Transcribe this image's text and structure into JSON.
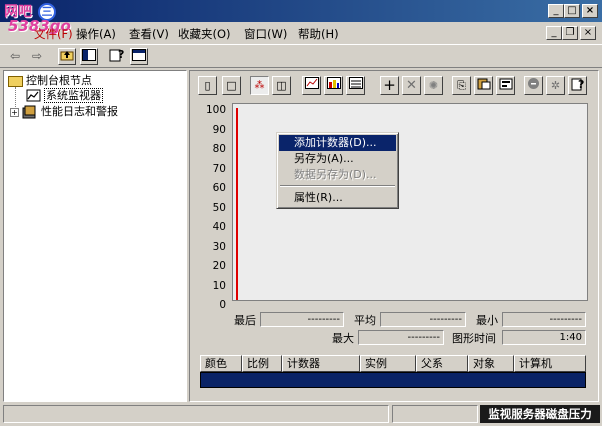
{
  "watermark": {
    "line1": "网吧",
    "line2": "5383go",
    "badge": "三"
  },
  "menu": {
    "file": "文件(F)",
    "action": "操作(A)",
    "view": "查看(V)",
    "favorites": "收藏夹(O)",
    "window": "窗口(W)",
    "help": "帮助(H)"
  },
  "tree": {
    "root": "控制台根节点",
    "items": [
      {
        "label": "系统监视器"
      },
      {
        "label": "性能日志和警报"
      }
    ]
  },
  "chart_data": {
    "type": "line",
    "title": "",
    "xlabel": "",
    "ylabel": "",
    "ylim": [
      0,
      100
    ],
    "yticks": [
      "100",
      "90",
      "80",
      "70",
      "60",
      "50",
      "40",
      "30",
      "20",
      "10",
      "0"
    ],
    "series": []
  },
  "stats": {
    "last_label": "最后",
    "last_value": "---------",
    "avg_label": "平均",
    "avg_value": "---------",
    "min_label": "最小",
    "min_value": "---------",
    "max_label": "最大",
    "max_value": "---------",
    "duration_label": "图形时间",
    "duration_value": "1:40"
  },
  "counter_table": {
    "columns": [
      "颜色",
      "比例",
      "计数器",
      "实例",
      "父系",
      "对象",
      "计算机"
    ]
  },
  "context_menu": {
    "items": [
      {
        "label": "添加计数器(D)...",
        "state": "highlighted"
      },
      {
        "label": "另存为(A)...",
        "state": "normal"
      },
      {
        "label": "数据另存为(D)...",
        "state": "disabled"
      },
      {
        "label": "属性(R)...",
        "state": "normal"
      }
    ]
  },
  "statusbar": {
    "right_text": "监视服务器磁盘压力"
  },
  "colors": {
    "titlebar": "#0a246a",
    "selection": "#0a246a",
    "graph_line": "#e00000",
    "chart_bg": "#ececec"
  }
}
